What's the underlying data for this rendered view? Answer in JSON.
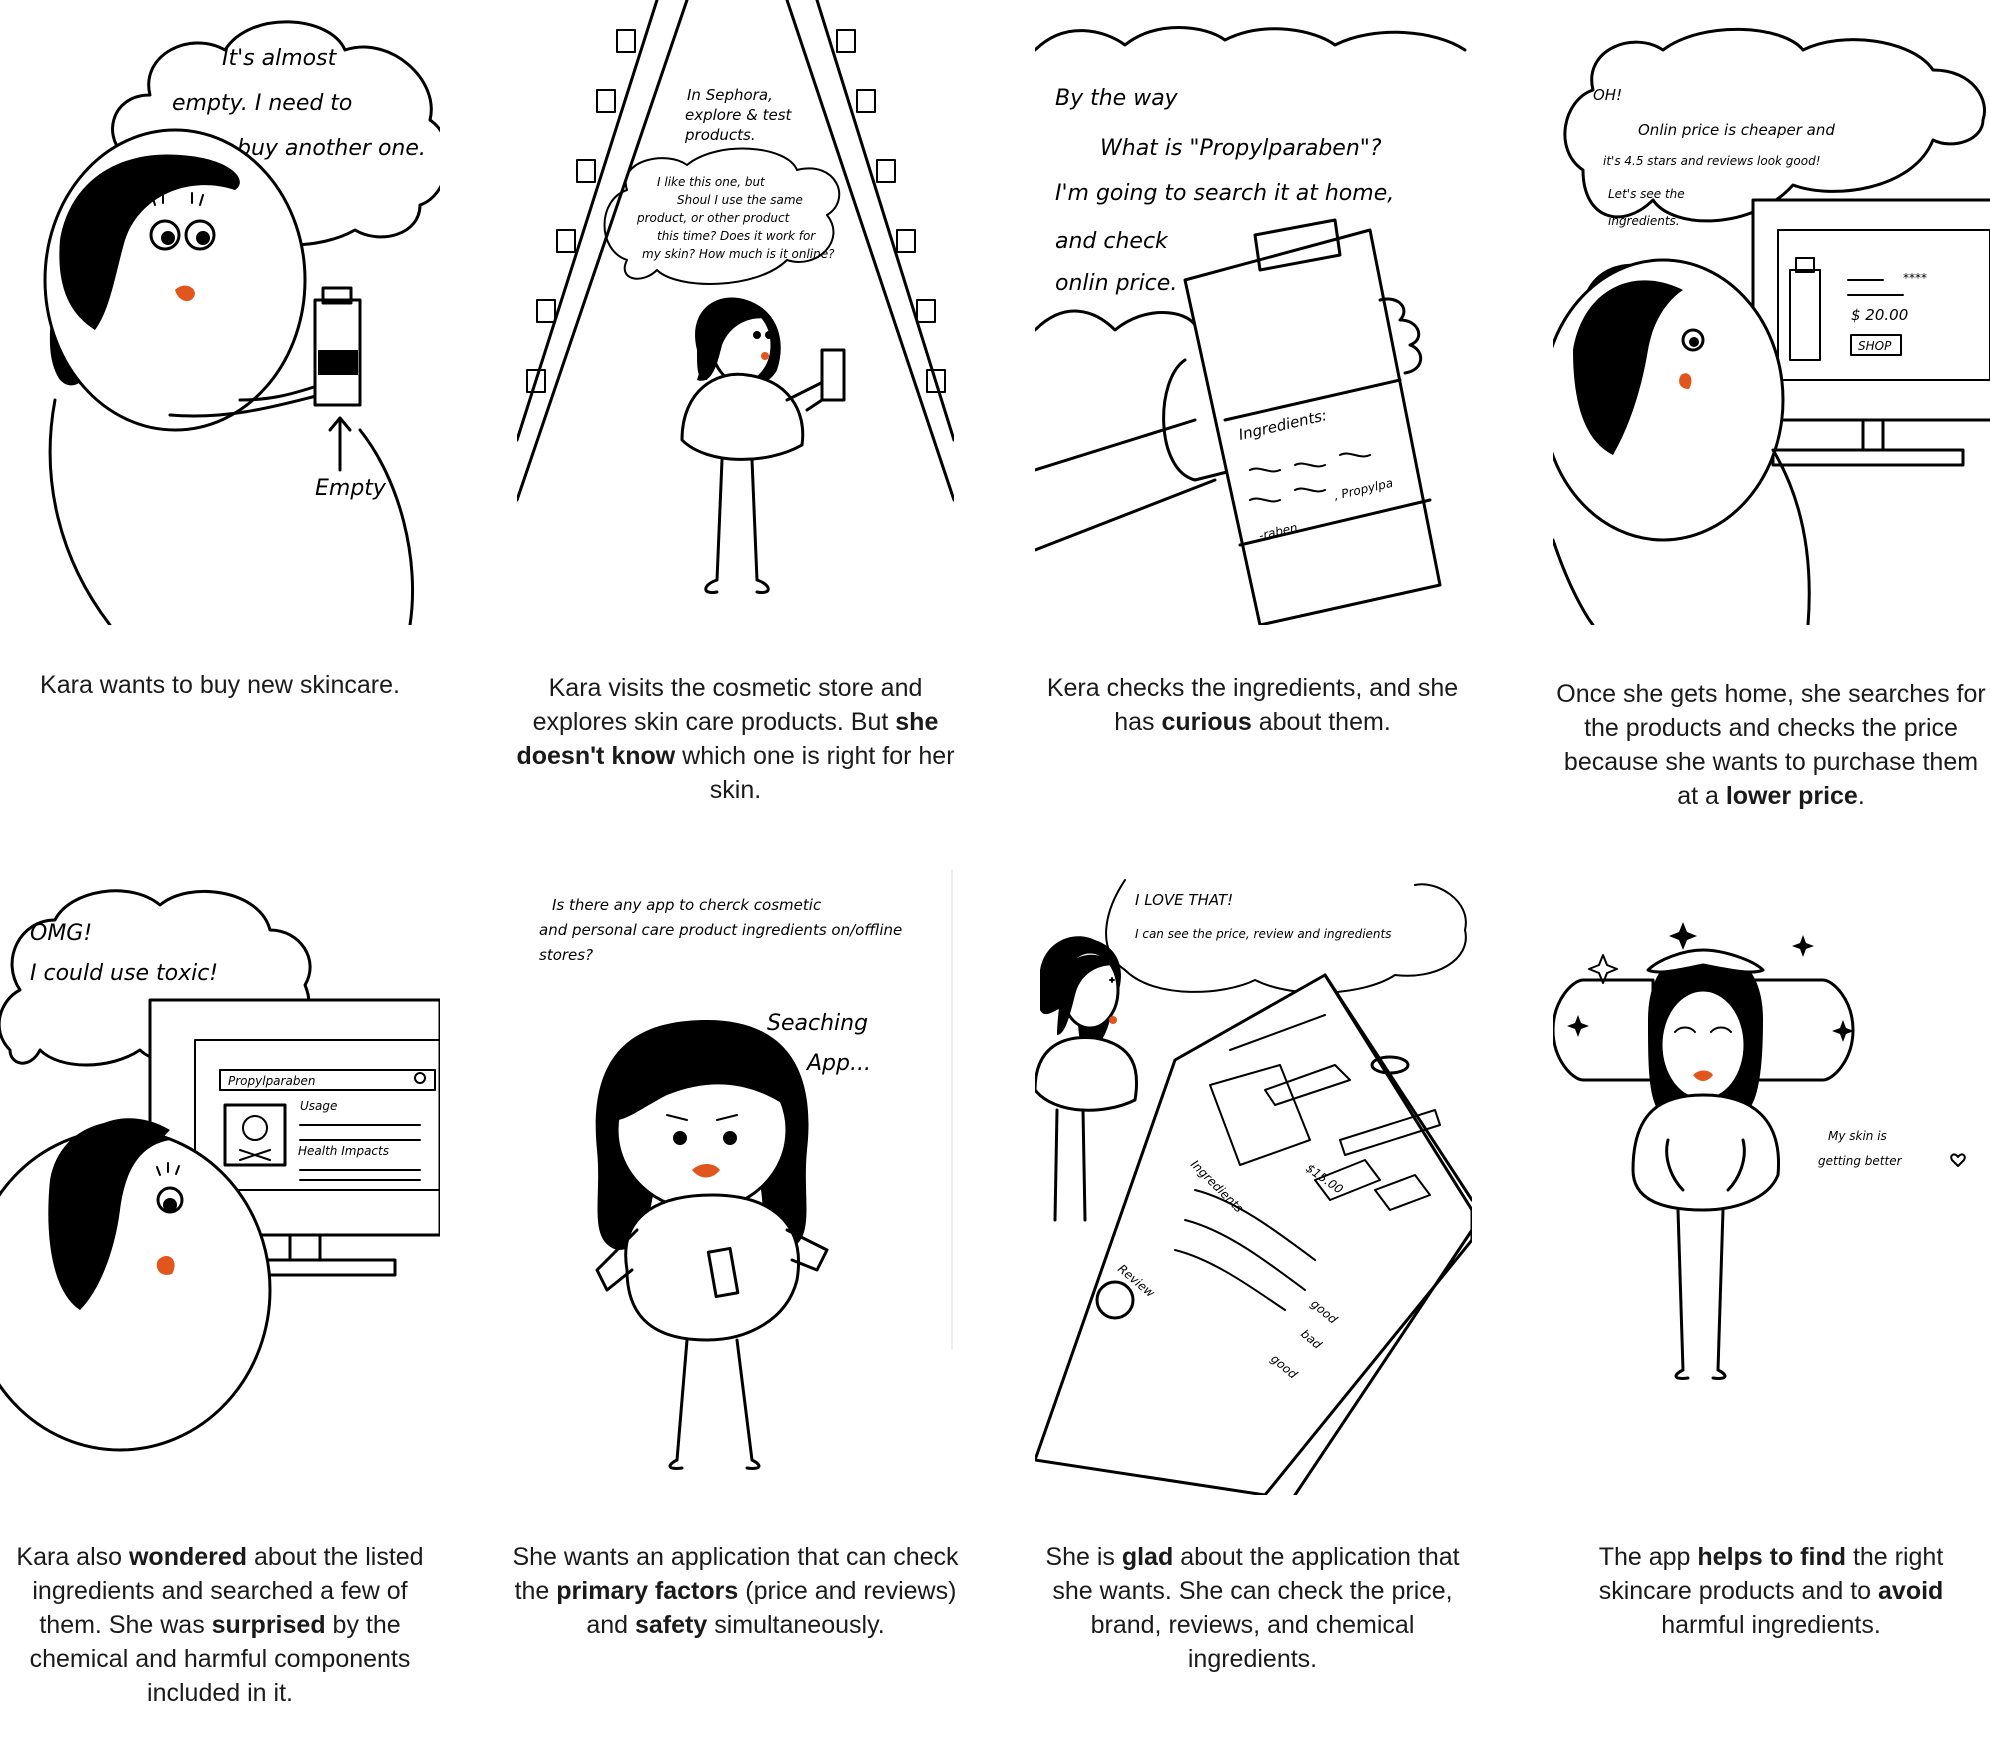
{
  "colors": {
    "lip": "#e0561c",
    "ink": "#000000",
    "caption_text": "#1a1a1a"
  },
  "panels": [
    {
      "speech": [
        "It's almost",
        "empty. I need to",
        "buy another one."
      ],
      "labels": [
        "Empty"
      ],
      "caption": [
        [
          "Kara wants to buy new skincare.",
          false
        ]
      ]
    },
    {
      "speech": [
        "In Sephora,",
        "explore & test",
        "products."
      ],
      "thought": [
        "I like this one, but",
        "Shoul I use the same",
        "product, or other product",
        "this time? Does it work for",
        "my skin? How much is it online?"
      ],
      "caption": [
        [
          "Kara visits the cosmetic store and explores skin care products. But ",
          false
        ],
        [
          "she doesn't know",
          true
        ],
        [
          " which one is right for her skin.",
          false
        ]
      ]
    },
    {
      "speech": [
        "By the way",
        "What is \"Propylparaben\"?",
        "I'm going to search it at home,",
        "and check",
        "onlin price."
      ],
      "labels": [
        "Ingredients:",
        ", Propylpa",
        "-raben"
      ],
      "caption": [
        [
          "Kera checks the ingredients, and she has ",
          false
        ],
        [
          "curious",
          true
        ],
        [
          " about them.",
          false
        ]
      ]
    },
    {
      "speech": [
        "OH!",
        "Onlin price is cheaper and",
        "it's 4.5 stars and reviews look good!",
        "Let's see the",
        "ingredients."
      ],
      "labels": [
        "$ 20.00",
        "SHOP",
        "****"
      ],
      "caption": [
        [
          "Once she gets home, she searches for the products and checks the price because she wants to purchase them at a ",
          false
        ],
        [
          "lower price",
          true
        ],
        [
          ".",
          false
        ]
      ]
    },
    {
      "speech": [
        "OMG!",
        "I could use toxic!"
      ],
      "labels": [
        "Propylparaben",
        "Usage",
        "Health Impacts"
      ],
      "caption": [
        [
          "Kara also ",
          false
        ],
        [
          "wondered",
          true
        ],
        [
          " about the listed ingredients and searched a few of them. She was ",
          false
        ],
        [
          "surprised",
          true
        ],
        [
          " by the chemical and harmful components included in it.",
          false
        ]
      ]
    },
    {
      "speech": [
        "Is there any app to cherck cosmetic",
        "and personal care product ingredients on/offline",
        "stores?"
      ],
      "labels": [
        "Seaching",
        "App..."
      ],
      "caption": [
        [
          "She wants an application that can check the ",
          false
        ],
        [
          "primary factors",
          true
        ],
        [
          " (price and reviews) and ",
          false
        ],
        [
          "safety",
          true
        ],
        [
          " simultaneously.",
          false
        ]
      ]
    },
    {
      "speech": [
        "I LOVE THAT!",
        "I can see the price, review and ingredients"
      ],
      "labels": [
        "Ingredients",
        "Review",
        "$15.00",
        "good",
        "bad",
        "good"
      ],
      "caption": [
        [
          "She is ",
          false
        ],
        [
          "glad",
          true
        ],
        [
          " about the application that she wants. She can check the price, brand, reviews, and chemical ingredients.",
          false
        ]
      ]
    },
    {
      "labels": [
        "My skin is",
        "getting better"
      ],
      "caption": [
        [
          "The app ",
          false
        ],
        [
          "helps to find",
          true
        ],
        [
          " the right skincare products and to ",
          false
        ],
        [
          "avoid",
          true
        ],
        [
          " harmful ingredients.",
          false
        ]
      ]
    }
  ]
}
